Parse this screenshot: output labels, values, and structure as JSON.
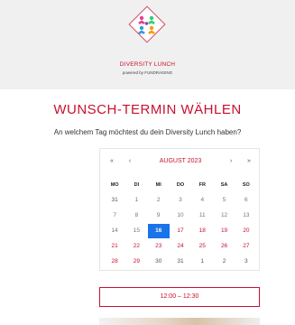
{
  "header": {
    "brand_name": "DIVERSITY LUNCH",
    "brand_sub": "powered by FUNDRAISING"
  },
  "page_title": "WUNSCH-TERMIN WÄHLEN",
  "question": "An welchem Tag möchtest du dein Diversity Lunch haben?",
  "calendar": {
    "nav_prev_year": "«",
    "nav_prev_month": "‹",
    "month_label": "AUGUST 2023",
    "nav_next_month": "›",
    "nav_next_year": "»",
    "weekdays": [
      "MO",
      "DI",
      "MI",
      "DO",
      "FR",
      "SA",
      "SO"
    ],
    "days": [
      {
        "label": "31",
        "state": "muted"
      },
      {
        "label": "1",
        "state": "disabled"
      },
      {
        "label": "2",
        "state": "disabled"
      },
      {
        "label": "3",
        "state": "disabled"
      },
      {
        "label": "4",
        "state": "disabled"
      },
      {
        "label": "5",
        "state": "disabled"
      },
      {
        "label": "6",
        "state": "disabled"
      },
      {
        "label": "7",
        "state": "disabled"
      },
      {
        "label": "8",
        "state": "disabled"
      },
      {
        "label": "9",
        "state": "disabled"
      },
      {
        "label": "10",
        "state": "disabled"
      },
      {
        "label": "11",
        "state": "disabled"
      },
      {
        "label": "12",
        "state": "disabled"
      },
      {
        "label": "13",
        "state": "disabled"
      },
      {
        "label": "14",
        "state": "disabled"
      },
      {
        "label": "15",
        "state": "disabled"
      },
      {
        "label": "16",
        "state": "selected"
      },
      {
        "label": "17",
        "state": "available"
      },
      {
        "label": "18",
        "state": "available"
      },
      {
        "label": "19",
        "state": "available"
      },
      {
        "label": "20",
        "state": "available"
      },
      {
        "label": "21",
        "state": "available"
      },
      {
        "label": "22",
        "state": "available"
      },
      {
        "label": "23",
        "state": "available"
      },
      {
        "label": "24",
        "state": "available"
      },
      {
        "label": "25",
        "state": "available"
      },
      {
        "label": "26",
        "state": "available"
      },
      {
        "label": "27",
        "state": "available"
      },
      {
        "label": "28",
        "state": "available"
      },
      {
        "label": "29",
        "state": "available"
      },
      {
        "label": "30",
        "state": "muted"
      },
      {
        "label": "31",
        "state": "muted"
      },
      {
        "label": "1",
        "state": "muted"
      },
      {
        "label": "2",
        "state": "muted"
      },
      {
        "label": "3",
        "state": "muted"
      }
    ]
  },
  "timeslot": "12:00 – 12:30",
  "colors": {
    "accent": "#c8102e",
    "selected": "#1a73e8",
    "header_bg": "#f0f0f0"
  },
  "icons": {
    "logo": "diversity-people-icon"
  }
}
